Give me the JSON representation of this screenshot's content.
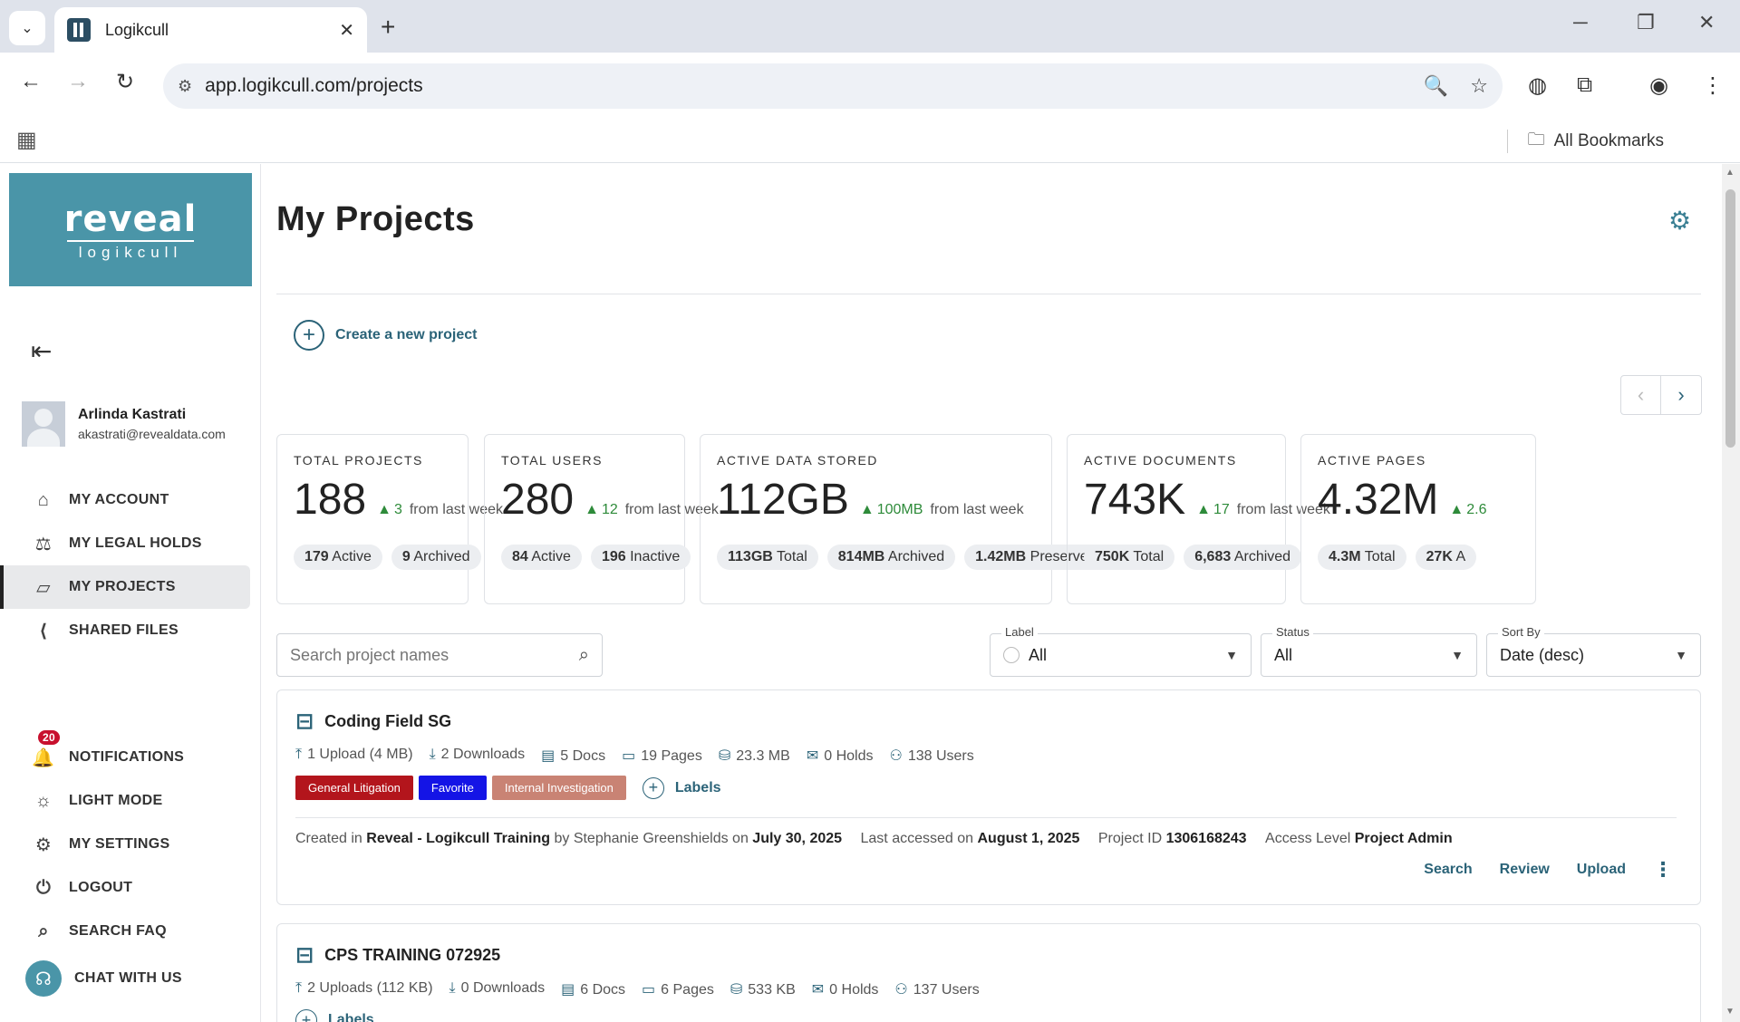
{
  "browser": {
    "tab_title": "Logikcull",
    "url": "app.logikcull.com/projects",
    "all_bookmarks": "All Bookmarks"
  },
  "logo": {
    "brand": "reveal",
    "sub": "logikcull"
  },
  "user": {
    "name": "Arlinda Kastrati",
    "email": "akastrati@revealdata.com"
  },
  "nav_top": [
    {
      "label": "MY ACCOUNT",
      "icon": "home-icon"
    },
    {
      "label": "MY LEGAL HOLDS",
      "icon": "gavel-icon"
    },
    {
      "label": "MY PROJECTS",
      "icon": "folder-icon",
      "active": true
    },
    {
      "label": "SHARED FILES",
      "icon": "share-icon"
    }
  ],
  "nav_bottom": {
    "notifications": {
      "label": "NOTIFICATIONS",
      "count": "20"
    },
    "light_mode": "LIGHT MODE",
    "settings": "MY SETTINGS",
    "logout": "LOGOUT",
    "faq": "SEARCH FAQ",
    "chat": "CHAT WITH US"
  },
  "main": {
    "title": "My Projects",
    "create": "Create a new project"
  },
  "stats": [
    {
      "label": "TOTAL PROJECTS",
      "value": "188",
      "delta": "3",
      "from": "from last week",
      "pills": [
        {
          "num": "179",
          "txt": "Active"
        },
        {
          "num": "9",
          "txt": "Archived"
        }
      ]
    },
    {
      "label": "TOTAL USERS",
      "value": "280",
      "delta": "12",
      "from": "from last week",
      "pills": [
        {
          "num": "84",
          "txt": "Active"
        },
        {
          "num": "196",
          "txt": "Inactive"
        }
      ]
    },
    {
      "label": "ACTIVE DATA STORED",
      "value": "112GB",
      "delta": "100MB",
      "from": "from last week",
      "pills": [
        {
          "num": "113GB",
          "txt": "Total"
        },
        {
          "num": "814MB",
          "txt": "Archived"
        },
        {
          "num": "1.42MB",
          "txt": "Preserved"
        }
      ]
    },
    {
      "label": "ACTIVE DOCUMENTS",
      "value": "743K",
      "delta": "17",
      "from": "from last week",
      "pills": [
        {
          "num": "750K",
          "txt": "Total"
        },
        {
          "num": "6,683",
          "txt": "Archived"
        }
      ]
    },
    {
      "label": "ACTIVE PAGES",
      "value": "4.32M",
      "delta": "2.6",
      "from": "",
      "pills": [
        {
          "num": "4.3M",
          "txt": "Total"
        },
        {
          "num": "27K",
          "txt": "A"
        }
      ]
    }
  ],
  "filters": {
    "search_placeholder": "Search project names",
    "label": {
      "title": "Label",
      "value": "All"
    },
    "status": {
      "title": "Status",
      "value": "All"
    },
    "sort": {
      "title": "Sort By",
      "value": "Date (desc)"
    }
  },
  "projects": [
    {
      "name": "Coding Field SG",
      "uploads": "1 Upload (4 MB)",
      "downloads": "2 Downloads",
      "docs": "5 Docs",
      "pages": "19 Pages",
      "size": "23.3 MB",
      "holds": "0 Holds",
      "users": "138 Users",
      "tags": [
        {
          "text": "General Litigation",
          "color": "#b3151c"
        },
        {
          "text": "Favorite",
          "color": "#1414e6"
        },
        {
          "text": "Internal Investigation",
          "color": "#c98374"
        }
      ],
      "labels_btn": "Labels",
      "created_prefix": "Created in",
      "workspace": "Reveal - Logikcull Training",
      "by": "by",
      "creator": "Stephanie Greenshields",
      "on": "on",
      "created_date": "July 30, 2025",
      "accessed_prefix": "Last accessed on",
      "accessed_date": "August 1, 2025",
      "id_prefix": "Project ID",
      "project_id": "1306168243",
      "access_prefix": "Access Level",
      "access": "Project Admin",
      "actions": {
        "search": "Search",
        "review": "Review",
        "upload": "Upload"
      }
    },
    {
      "name": "CPS TRAINING 072925",
      "uploads": "2 Uploads (112 KB)",
      "downloads": "0 Downloads",
      "docs": "6 Docs",
      "pages": "6 Pages",
      "size": "533 KB",
      "holds": "0 Holds",
      "users": "137 Users",
      "labels_btn": "Labels"
    }
  ]
}
